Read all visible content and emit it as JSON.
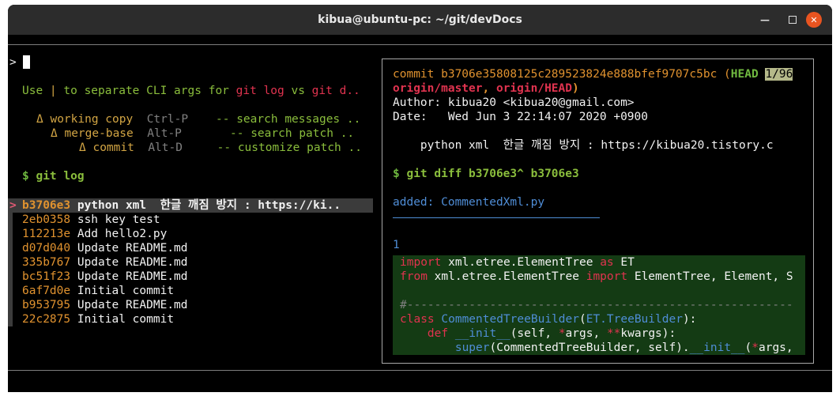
{
  "window": {
    "title": "kibua@ubuntu-pc: ~/git/devDocs",
    "min_icon": "minimize-icon",
    "max_icon": "maximize-icon",
    "close_icon": "close-icon"
  },
  "prompt": {
    "symbol": ">"
  },
  "header": {
    "hint_pre": "Use ",
    "hint_pipe": "|",
    "hint_mid": " to separate CLI args for ",
    "hint_gitlog": "git log",
    "hint_vs": " vs ",
    "hint_gitd": "git d..",
    "modes": [
      {
        "delta": "Δ",
        "name": "working copy",
        "key": "Ctrl-P",
        "action": "-- search messages .."
      },
      {
        "delta": "Δ",
        "name": "merge-base",
        "key": "Alt-P",
        "action": "-- search patch .."
      },
      {
        "delta": "Δ",
        "name": "commit",
        "key": "Alt-D",
        "action": "-- customize patch .."
      }
    ],
    "command_dollar": "$",
    "command": "git log"
  },
  "commits": [
    {
      "hash": "b3706e3",
      "msg": "python xml  한글 깨짐 방지 : https://ki..",
      "selected": true
    },
    {
      "hash": "2eb0358",
      "msg": "ssh key test"
    },
    {
      "hash": "112213e",
      "msg": "Add hello2.py"
    },
    {
      "hash": "d07d040",
      "msg": "Update README.md"
    },
    {
      "hash": "335b767",
      "msg": "Update README.md"
    },
    {
      "hash": "bc51f23",
      "msg": "Update README.md"
    },
    {
      "hash": "6af7d0e",
      "msg": "Initial commit"
    },
    {
      "hash": "b953795",
      "msg": "Update README.md"
    },
    {
      "hash": "22c2875",
      "msg": "Initial commit"
    }
  ],
  "selector": ">",
  "preview": {
    "commit_label": "commit b3706e35808125c289523824e888bfef9707c5bc",
    "paren_open": " (",
    "head": "HEAD",
    "position": "1/96",
    "origin_master": "origin/master",
    "comma": ", ",
    "origin_head": "origin/HEAD",
    "paren_close": ")",
    "author": "Author: kibua20 <kibua20@gmail.com>",
    "date": "Date:   Wed Jun 3 22:14:07 2020 +0900",
    "message": "    python xml  한글 깨짐 방지 : https://kibua20.tistory.c",
    "diff_dollar": "$",
    "diff_cmd": "git diff b3706e3^ b3706e3",
    "added_label": "added: CommentedXml.py",
    "line_no": "1",
    "code": {
      "l1_kw": "import",
      "l1_rest": " xml.etree.ElementTree ",
      "l1_as": "as",
      "l1_end": " ET",
      "l2_kw": "from",
      "l2_mid": " xml.etree.ElementTree ",
      "l2_import": "import",
      "l2_end": " ElementTree, Element, S",
      "l3": "#--------------------------------------------------------",
      "l4_kw": "class",
      "l4_name": " CommentedTreeBuilder",
      "l4_paren": "(",
      "l4_base": "ET.TreeBuilder",
      "l4_end": "):",
      "l5_indent": "    ",
      "l5_kw": "def",
      "l5_name": " __init__",
      "l5_args1": "(self, ",
      "l5_star1": "*",
      "l5_args2": "args, ",
      "l5_star2": "**",
      "l5_kwargs": "kwargs",
      "l5_end": "):",
      "l6_indent": "        ",
      "l6_super": "super",
      "l6_mid": "(CommentedTreeBuilder, self).",
      "l6_init": "__init__",
      "l6_paren": "(",
      "l6_star": "*",
      "l6_end": "args,"
    }
  }
}
